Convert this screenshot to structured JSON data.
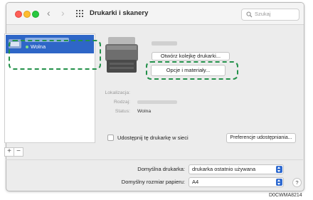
{
  "window": {
    "title": "Drukarki i skanery",
    "search": {
      "placeholder": "Szukaj"
    },
    "nav": {
      "back_glyph": "‹",
      "forward_glyph": "›",
      "grid_icon": "grid-icon"
    }
  },
  "printer_list": {
    "items": [
      {
        "status": "Wolna",
        "selected": true
      }
    ],
    "add_label": "+",
    "remove_label": "−"
  },
  "details": {
    "buttons": {
      "queue": "Otwórz kolejkę drukarki...",
      "options": "Opcje i materiały..."
    },
    "location_label": "Lokalizacja:",
    "kind_label": "Rodzaj:",
    "status_label": "Status:",
    "status_value": "Wolna"
  },
  "sharing": {
    "checkbox_label": "Udostępnij tę drukarkę w sieci",
    "checked": false,
    "preferences_button": "Preferencje udostępniania..."
  },
  "defaults": {
    "printer_label": "Domyślna drukarka:",
    "printer_value": "drukarka ostatnio używana",
    "paper_label": "Domyślny rozmiar papieru:",
    "paper_value": "A4",
    "help_label": "?"
  },
  "annotation": {
    "highlight_color": "#23914a",
    "figure_code": "D0CWMA8214"
  },
  "colors": {
    "selection": "#2e66c7",
    "accent": "#2f6ad0",
    "traffic_red": "#fe5f57",
    "traffic_yellow": "#febc2e",
    "traffic_green": "#28c840"
  }
}
